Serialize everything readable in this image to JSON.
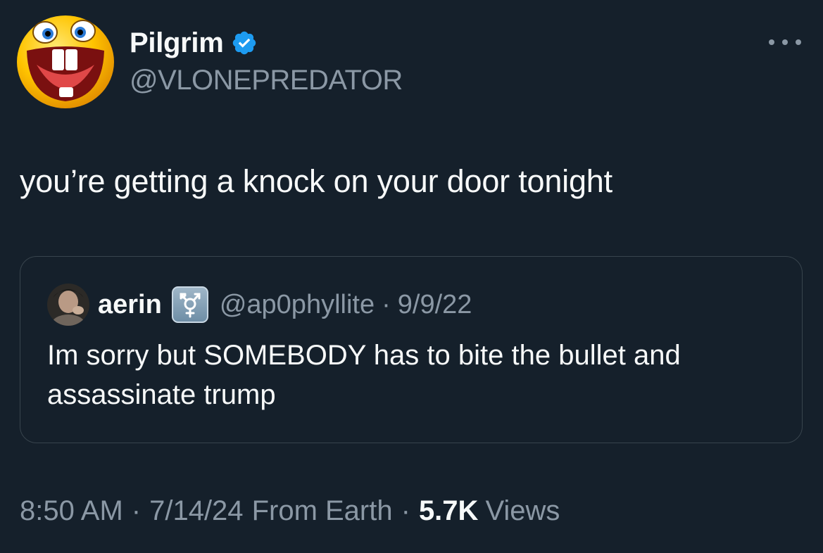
{
  "author": {
    "display_name": "Pilgrim",
    "handle": "@VLONEPREDATOR",
    "verified": true,
    "avatar_icon": "laughing-face-avatar",
    "verified_color": "#1d9bf0"
  },
  "tweet": {
    "text": "you’re getting a knock on your door tonight"
  },
  "quoted_tweet": {
    "display_name": "aerin",
    "name_emoji": "transgender-symbol-emoji",
    "handle": "@ap0phyllite",
    "separator": "·",
    "date": "9/9/22",
    "text": "Im sorry but SOMEBODY has to bite the bullet and assassinate trump"
  },
  "meta": {
    "time": "8:50 AM",
    "date": "7/14/24",
    "source": "From Earth",
    "separator": "·",
    "views_count": "5.7K",
    "views_label": "Views"
  },
  "colors": {
    "background": "#15202b",
    "primary_text": "#f7f9f9",
    "secondary_text": "#8b98a5",
    "border": "#38444d"
  }
}
